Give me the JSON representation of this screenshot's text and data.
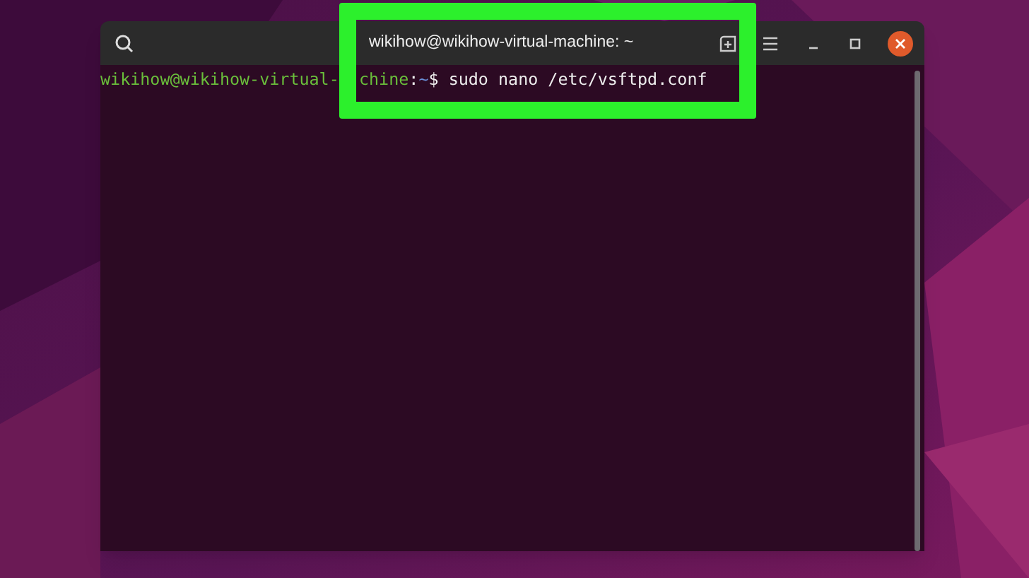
{
  "window": {
    "title": "wikihow@wikihow-virtual-machine: ~"
  },
  "terminal": {
    "prompt_user_start": "wikihow@wikihow-virtual-",
    "prompt_user_end": "chine",
    "prompt_sep": ":",
    "prompt_path": "~",
    "prompt_symbol": "$",
    "command": "sudo nano /etc/vsftpd.conf"
  },
  "highlight": {
    "color": "#2cf02c"
  }
}
